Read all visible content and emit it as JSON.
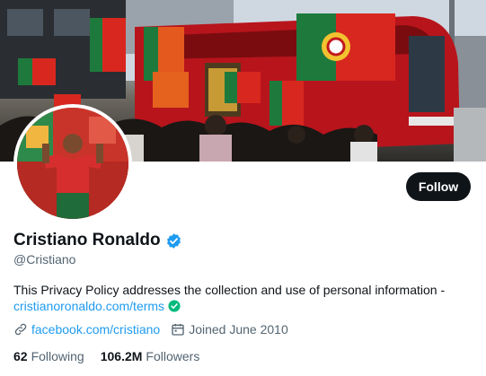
{
  "profile": {
    "name": "Cristiano Ronaldo",
    "handle": "@Cristiano",
    "bio_text": "This Privacy Policy addresses the collection and use of personal information - ",
    "bio_link": "cristianoronaldo.com/terms",
    "website": "facebook.com/cristiano",
    "joined": "Joined June 2010",
    "following_count": "62",
    "following_label": "Following",
    "followers_count": "106.2M",
    "followers_label": "Followers"
  },
  "actions": {
    "follow_label": "Follow"
  },
  "icons": {
    "verified": "verified-badge-icon",
    "link": "link-icon",
    "calendar": "calendar-icon",
    "bio_check": "check-circle-icon"
  },
  "colors": {
    "accent": "#1d9bf0",
    "text_primary": "#0f1419",
    "text_secondary": "#536471",
    "button_bg": "#0f1419",
    "bio_check": "#00ba7c",
    "flag_green": "#1e7a3c",
    "flag_red": "#d8271f",
    "bus_red": "#b8141c"
  }
}
